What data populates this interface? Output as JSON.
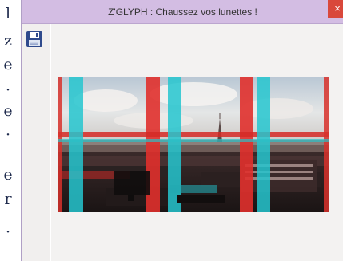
{
  "window": {
    "title": "Z'GLYPH : Chaussez vos lunettes !",
    "close_label": "×"
  },
  "left_strip": {
    "glyphs": [
      "l",
      "z",
      "e",
      "·",
      "e",
      "·",
      "e",
      "r",
      "·"
    ]
  },
  "toolbar": {
    "save_icon": "floppy-disk-icon"
  },
  "image": {
    "subject": "anaglyph-photo",
    "colors": {
      "red_channel": "#e0302c",
      "cyan_channel": "#25c6cf"
    }
  }
}
